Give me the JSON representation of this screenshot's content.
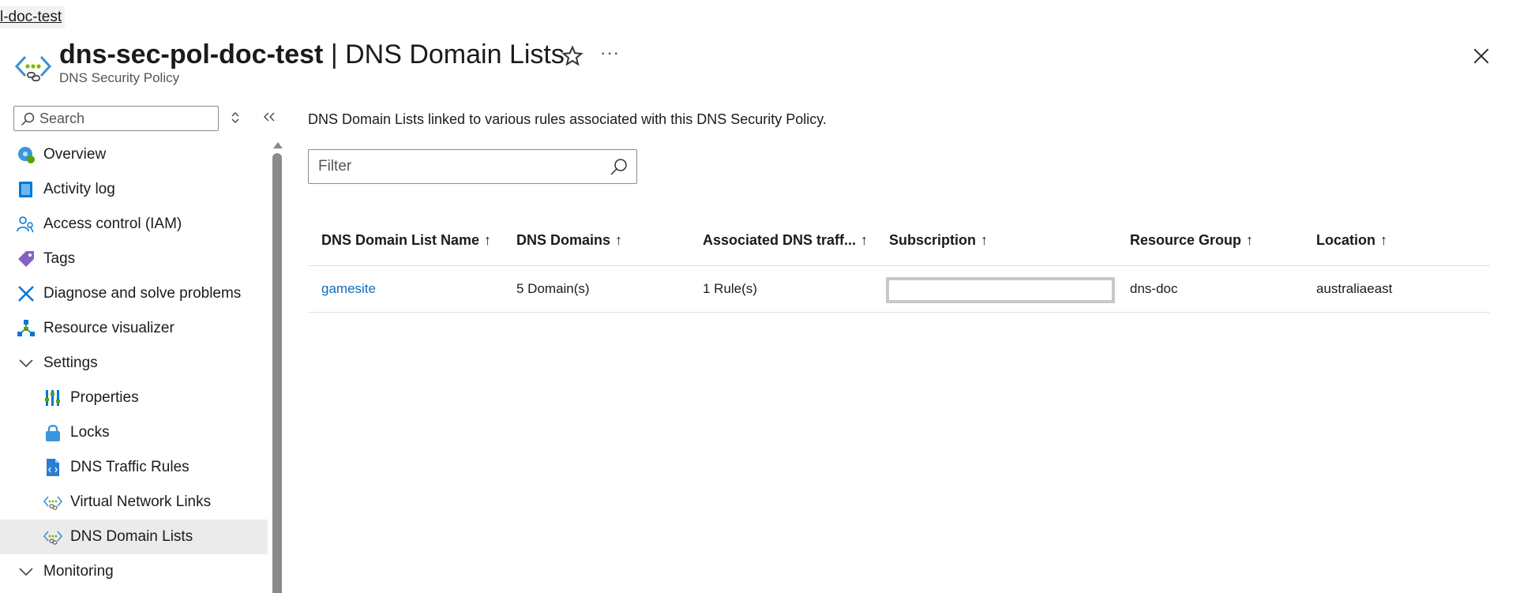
{
  "breadcrumb": {
    "text": "l-doc-test"
  },
  "header": {
    "resource_name": "dns-sec-pol-doc-test",
    "separator": "|",
    "page_name": "DNS Domain Lists",
    "subtitle": "DNS Security Policy",
    "more_label": "···"
  },
  "sidebar": {
    "search_placeholder": "Search",
    "items": [
      {
        "label": "Overview",
        "icon": "overview-icon"
      },
      {
        "label": "Activity log",
        "icon": "activity-log-icon"
      },
      {
        "label": "Access control (IAM)",
        "icon": "iam-icon"
      },
      {
        "label": "Tags",
        "icon": "tag-icon"
      },
      {
        "label": "Diagnose and solve problems",
        "icon": "diagnose-icon"
      },
      {
        "label": "Resource visualizer",
        "icon": "resource-visualizer-icon"
      },
      {
        "label": "Settings",
        "icon": "chevron-down-icon",
        "expanded": true
      },
      {
        "label": "Properties",
        "icon": "properties-icon"
      },
      {
        "label": "Locks",
        "icon": "lock-icon"
      },
      {
        "label": "DNS Traffic Rules",
        "icon": "dns-traffic-rules-icon"
      },
      {
        "label": "Virtual Network Links",
        "icon": "network-link-icon"
      },
      {
        "label": "DNS Domain Lists",
        "icon": "network-link-icon",
        "selected": true
      },
      {
        "label": "Monitoring",
        "icon": "chevron-down-icon",
        "expanded": true
      }
    ]
  },
  "main": {
    "description": "DNS Domain Lists linked to various rules associated with this DNS Security Policy.",
    "filter_placeholder": "Filter",
    "columns": [
      {
        "label": "DNS Domain List Name",
        "sort": "↑"
      },
      {
        "label": "DNS Domains",
        "sort": "↑"
      },
      {
        "label": "Associated DNS traff...",
        "sort": "↑"
      },
      {
        "label": "Subscription",
        "sort": "↑"
      },
      {
        "label": "Resource Group",
        "sort": "↑"
      },
      {
        "label": "Location",
        "sort": "↑"
      }
    ],
    "rows": [
      {
        "name": "gamesite",
        "domains": "5 Domain(s)",
        "rules": "1 Rule(s)",
        "subscription": "",
        "resource_group": "dns-doc",
        "location": "australiaeast"
      }
    ]
  },
  "colors": {
    "link": "#0f6cbd",
    "selected_bg": "#ebebeb",
    "azure_blue": "#0078d4"
  }
}
